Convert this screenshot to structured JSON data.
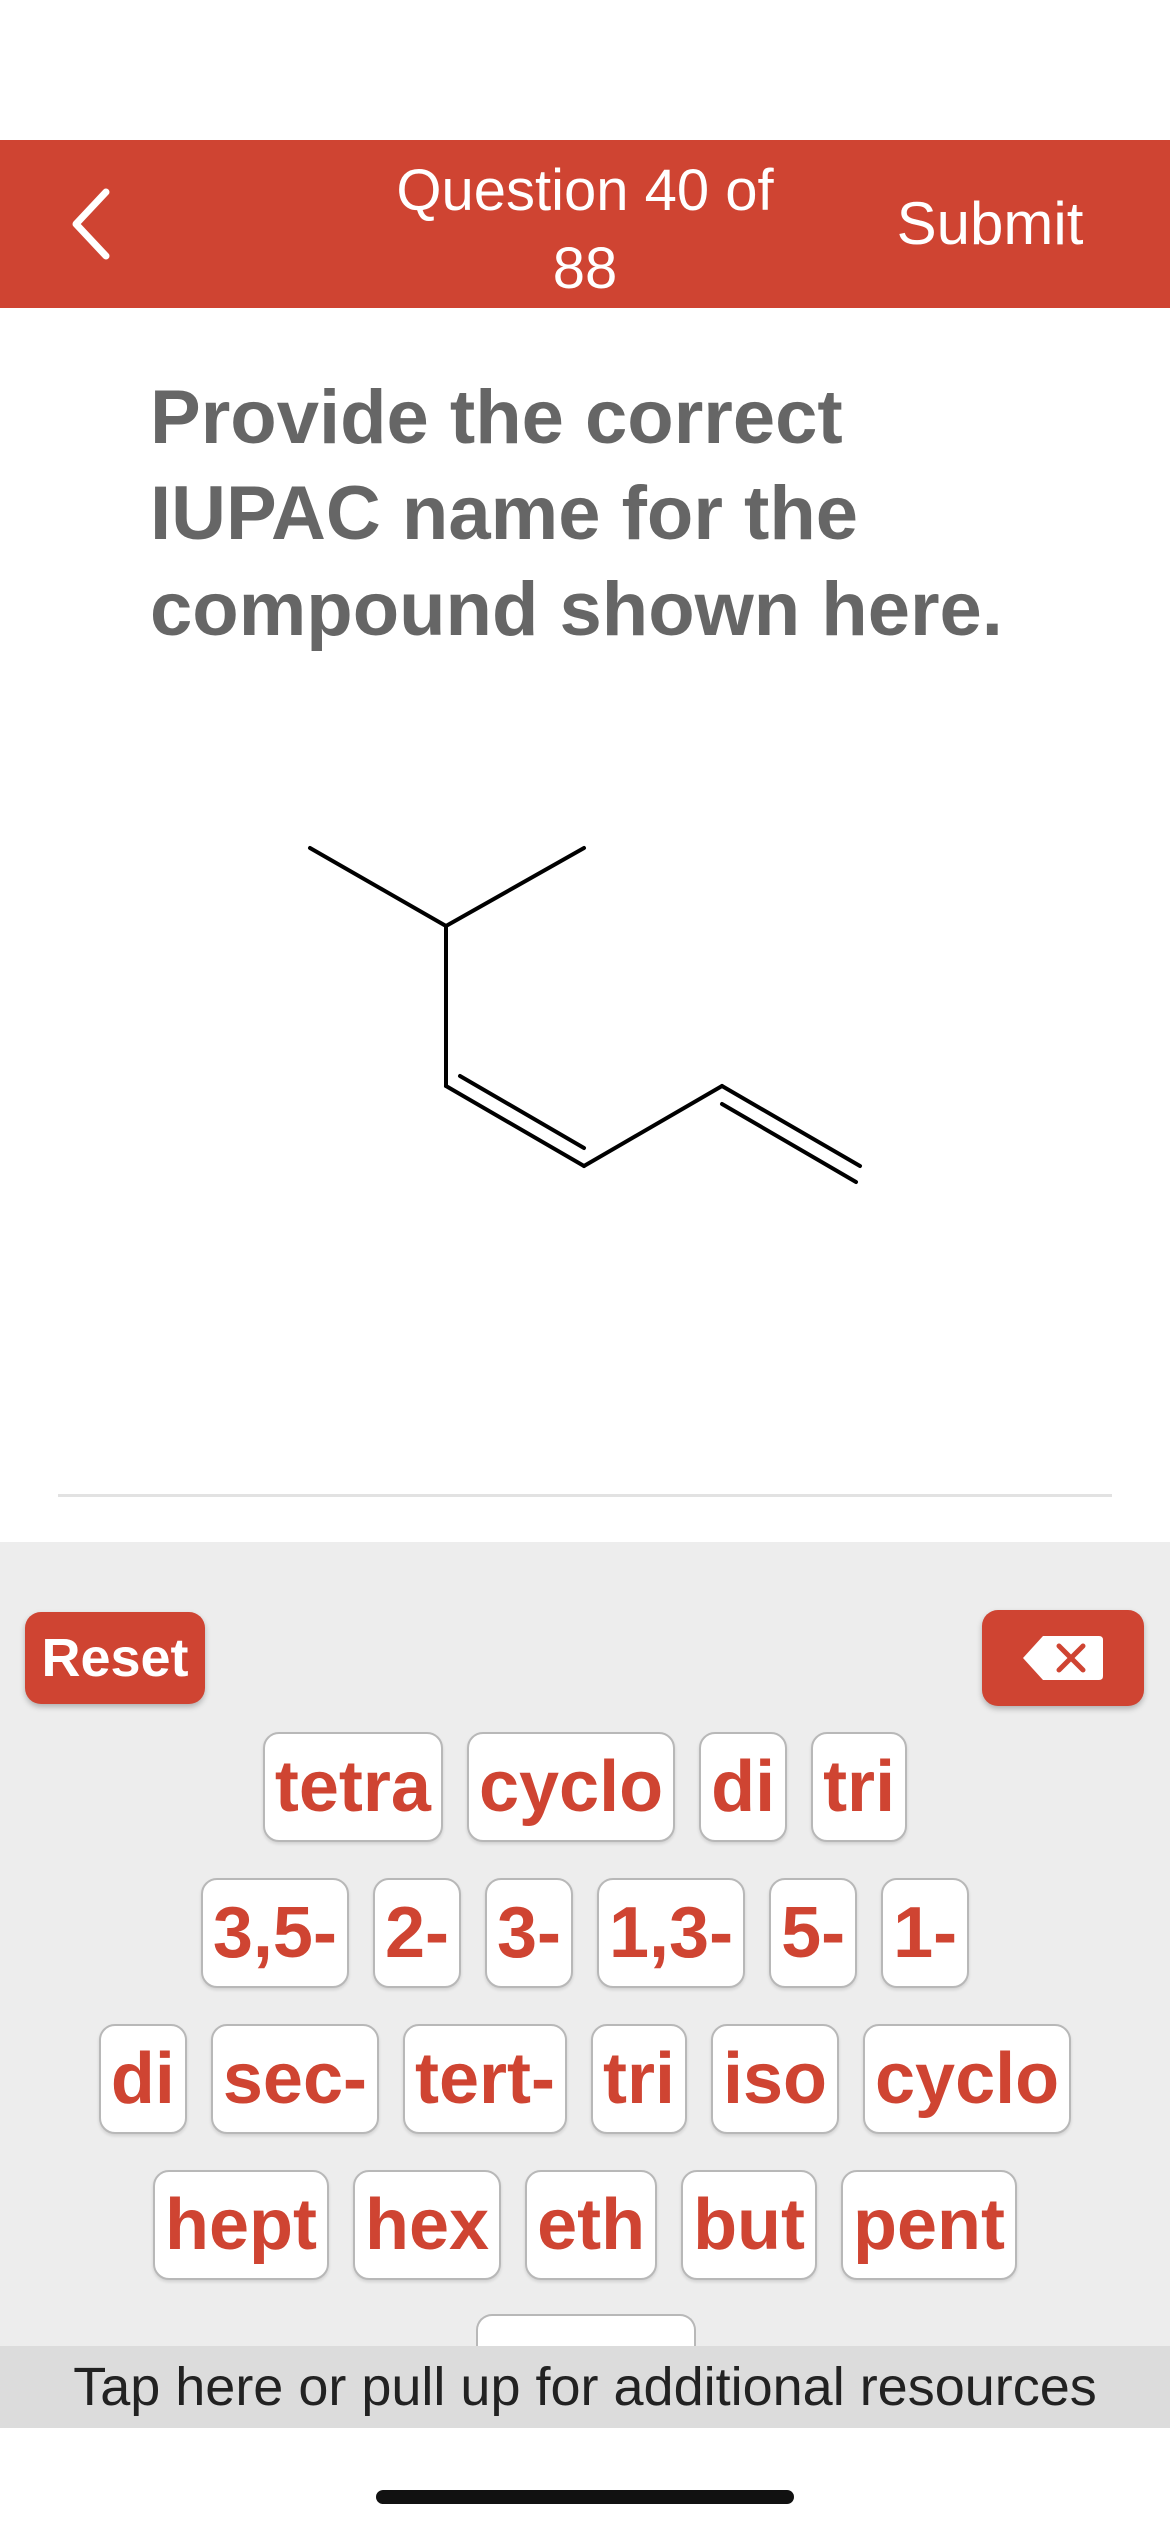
{
  "header": {
    "title_line1": "Question 40 of",
    "title_line2": "88",
    "submit_label": "Submit",
    "back_icon": "chevron-left-icon",
    "color": "#cf4432"
  },
  "question": {
    "line1": "Provide the correct",
    "line2": "IUPAC name for the",
    "line3": "compound shown here."
  },
  "keyboard": {
    "reset_label": "Reset",
    "backspace_icon": "backspace-icon",
    "rows": [
      [
        "tetra",
        "cyclo",
        "di",
        "tri"
      ],
      [
        "3,5-",
        "2-",
        "3-",
        "1,3-",
        "5-",
        "1-"
      ],
      [
        "di",
        "sec-",
        "tert-",
        "tri",
        "iso",
        "cyclo"
      ],
      [
        "hept",
        "hex",
        "eth",
        "but",
        "pent"
      ]
    ]
  },
  "footer": {
    "resources_label": "Tap here or pull up for additional resources"
  }
}
